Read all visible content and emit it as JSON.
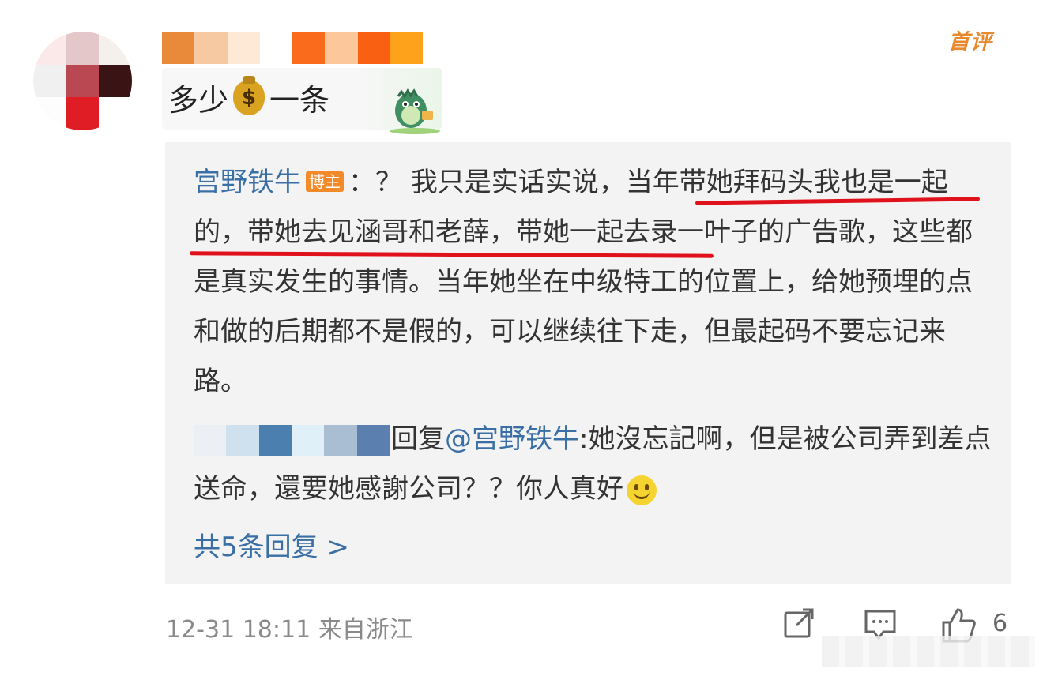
{
  "post": {
    "first_badge": "首评",
    "comment": {
      "before": "多少",
      "emoji_icon": "money-bag",
      "after": "一条"
    }
  },
  "reply": {
    "author": "宫野铁牛",
    "author_tag": "博主",
    "separator": "：",
    "segment_plain_1": "？ 我只是实话实说，",
    "segment_underlined_1": "当年带她拜码头我",
    "segment_underlined_2": "也是一起的，带她去见涵哥和老薛，",
    "segment_plain_2": "带她一起去录一叶子的广告歌，这些都是真实发生的事情。当年她坐在中级特工的位置上，给她预埋的点和做的后期都不是假的，可以继续往下走，但最起码不要忘记来路。",
    "sub_reply": {
      "reply_word": "回复",
      "mention": "@宫野铁牛",
      "text": ":她沒忘記啊，但是被公司弄到差点送命，還要她感謝公司？？你人真好",
      "emoji_icon": "smile"
    },
    "more_replies": "共5条回复 >"
  },
  "footer": {
    "timestamp": "12-31 18:11",
    "location": "来自浙江",
    "like_count": "6"
  },
  "colors": {
    "accent_blue": "#3a6fa6",
    "underline_red": "#e0111b",
    "tag_orange": "#f28a2a",
    "first_badge": "#e8892d"
  }
}
